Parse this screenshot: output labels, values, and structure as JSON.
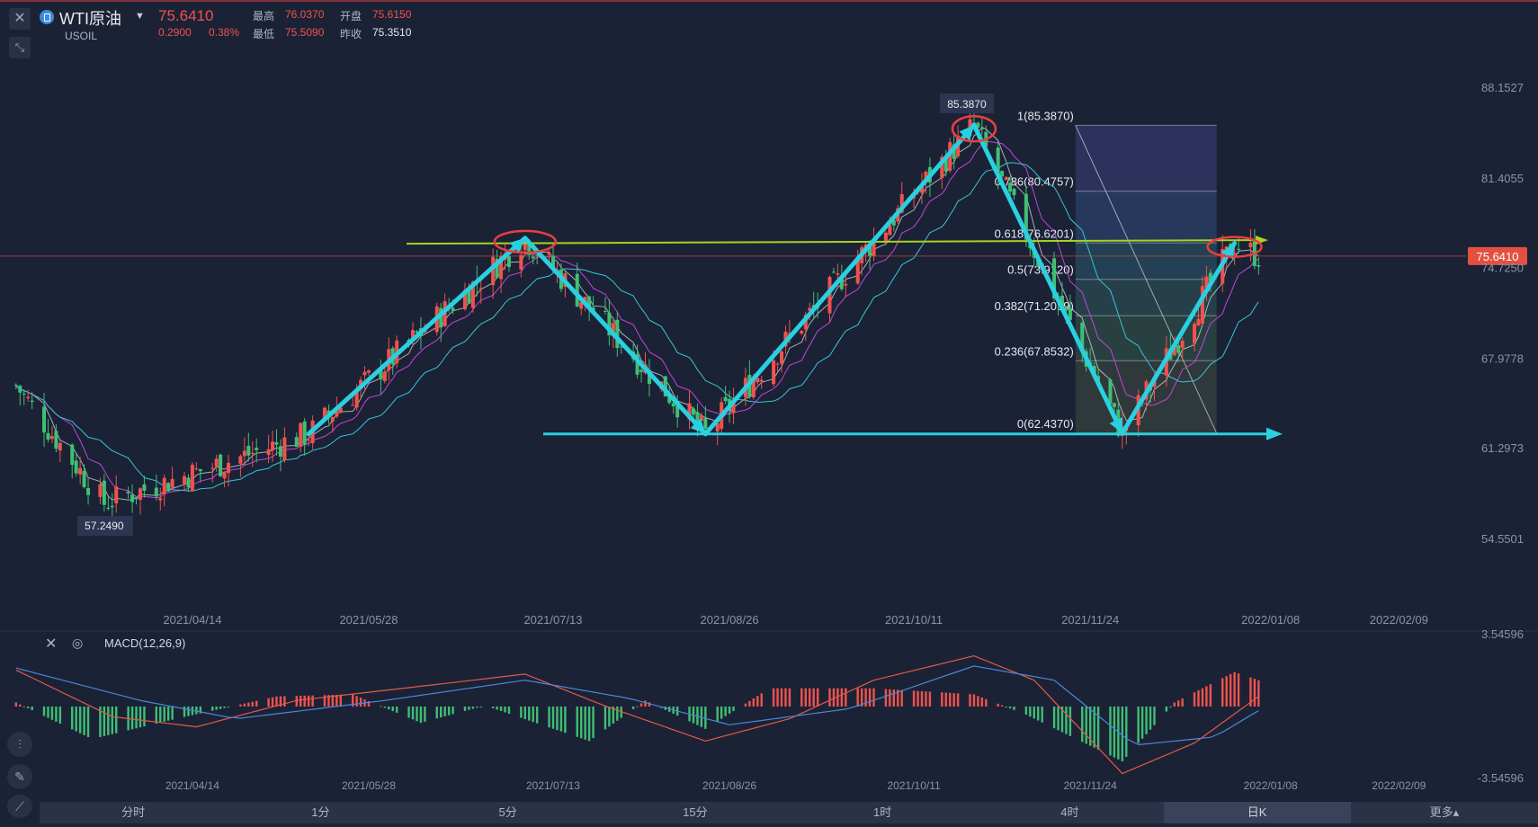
{
  "header": {
    "symbol_name": "WTI原油",
    "symbol_code": "USOIL",
    "last_price": "75.6410",
    "change": "0.2900",
    "change_pct": "0.38%",
    "high_label": "最高",
    "high": "76.0370",
    "open_label": "开盘",
    "open": "75.6150",
    "low_label": "最低",
    "low": "75.5090",
    "prev_close_label": "昨收",
    "prev_close": "75.3510"
  },
  "colors": {
    "background": "#1b2236",
    "up": "#f0524d",
    "down": "#3fbf74",
    "arrow": "#2ad0e0",
    "neckline": "#a8d320",
    "marker": "#e84040",
    "ma_magenta": "#c246d6",
    "ma_cyan": "#35c7d6",
    "macd_line": "#e15a46",
    "signal_line": "#4a87d6"
  },
  "chart_data": [
    {
      "type": "candlestick",
      "title": "",
      "x": [
        "2021/04/14",
        "2021/05/28",
        "2021/07/13",
        "2021/08/26",
        "2021/10/11",
        "2021/11/24",
        "2022/01/08",
        "2022/02/09"
      ],
      "y_ticks": [
        "88.1527",
        "81.4055",
        "74.7250",
        "67.9778",
        "61.2973",
        "54.5501"
      ],
      "ylim": [
        52.5,
        89.5
      ],
      "last_price_tag": "75.6410",
      "high_marker": "85.3870",
      "low_marker": "57.2490",
      "swing_points": [
        {
          "date": "2021/03/01",
          "value": 66.0
        },
        {
          "date": "2021/03/23",
          "value": 57.25
        },
        {
          "date": "2021/05/13",
          "value": 62.4
        },
        {
          "date": "2021/07/06",
          "value": 76.98
        },
        {
          "date": "2021/08/20",
          "value": 62.4
        },
        {
          "date": "2021/10/26",
          "value": 85.39
        },
        {
          "date": "2021/12/02",
          "value": 62.44
        },
        {
          "date": "2021/12/30",
          "value": 76.6
        },
        {
          "date": "2022/01/05",
          "value": 75.64
        }
      ],
      "fibonacci": {
        "levels": [
          {
            "ratio": "1",
            "value": "85.3870",
            "label": "1(85.3870)"
          },
          {
            "ratio": "0.786",
            "value": "80.4757",
            "label": "0.786(80.4757)"
          },
          {
            "ratio": "0.618",
            "value": "76.6201",
            "label": "0.618(76.6201)"
          },
          {
            "ratio": "0.5",
            "value": "73.9120",
            "label": "0.5(73.9120)"
          },
          {
            "ratio": "0.382",
            "value": "71.2039",
            "label": "0.382(71.2039)"
          },
          {
            "ratio": "0.236",
            "value": "67.8532",
            "label": "0.236(67.8532)"
          },
          {
            "ratio": "0",
            "value": "62.4370",
            "label": "0(62.4370)"
          }
        ]
      },
      "neckline_value": 76.7,
      "support_value": 62.4
    },
    {
      "type": "bar",
      "indicator_label": "MACD(12,26,9)",
      "y_ticks": [
        "3.54596",
        "-3.54596"
      ],
      "ylim": [
        -3.54596,
        3.54596
      ],
      "x": [
        "2021/04/14",
        "2021/05/28",
        "2021/07/13",
        "2021/08/26",
        "2021/10/11",
        "2021/11/24",
        "2022/01/08",
        "2022/02/09"
      ],
      "histogram_points": [
        {
          "date": "2021/03/01",
          "value": 0.2
        },
        {
          "date": "2021/03/20",
          "value": -1.6
        },
        {
          "date": "2021/04/10",
          "value": -0.6
        },
        {
          "date": "2021/05/05",
          "value": 0.5
        },
        {
          "date": "2021/05/24",
          "value": 0.6
        },
        {
          "date": "2021/06/10",
          "value": -0.8
        },
        {
          "date": "2021/06/26",
          "value": 0.05
        },
        {
          "date": "2021/07/22",
          "value": -1.7
        },
        {
          "date": "2021/08/05",
          "value": 0.3
        },
        {
          "date": "2021/08/20",
          "value": -1.1
        },
        {
          "date": "2021/09/05",
          "value": 0.9
        },
        {
          "date": "2021/10/01",
          "value": 0.9
        },
        {
          "date": "2021/10/26",
          "value": 0.6
        },
        {
          "date": "2021/11/08",
          "value": -0.4
        },
        {
          "date": "2021/12/02",
          "value": -2.7
        },
        {
          "date": "2021/12/15",
          "value": 0.2
        },
        {
          "date": "2021/12/30",
          "value": 1.7
        },
        {
          "date": "2022/01/05",
          "value": 1.3
        }
      ],
      "macd_points": [
        {
          "date": "2021/03/01",
          "value": 1.8
        },
        {
          "date": "2021/03/25",
          "value": -0.5
        },
        {
          "date": "2021/04/15",
          "value": -1.0
        },
        {
          "date": "2021/05/10",
          "value": 0.3
        },
        {
          "date": "2021/06/10",
          "value": 1.0
        },
        {
          "date": "2021/07/06",
          "value": 1.6
        },
        {
          "date": "2021/07/25",
          "value": 0.1
        },
        {
          "date": "2021/08/20",
          "value": -1.7
        },
        {
          "date": "2021/09/10",
          "value": -0.6
        },
        {
          "date": "2021/10/01",
          "value": 1.3
        },
        {
          "date": "2021/10/26",
          "value": 2.5
        },
        {
          "date": "2021/11/10",
          "value": 1.3
        },
        {
          "date": "2021/12/02",
          "value": -3.3
        },
        {
          "date": "2021/12/20",
          "value": -1.8
        },
        {
          "date": "2022/01/05",
          "value": 0.5
        }
      ],
      "signal_points": [
        {
          "date": "2021/03/01",
          "value": 1.9
        },
        {
          "date": "2021/04/01",
          "value": 0.3
        },
        {
          "date": "2021/04/25",
          "value": -0.6
        },
        {
          "date": "2021/06/01",
          "value": 0.3
        },
        {
          "date": "2021/07/06",
          "value": 1.3
        },
        {
          "date": "2021/08/01",
          "value": 0.4
        },
        {
          "date": "2021/08/26",
          "value": -0.9
        },
        {
          "date": "2021/09/25",
          "value": -0.1
        },
        {
          "date": "2021/10/26",
          "value": 2.0
        },
        {
          "date": "2021/11/15",
          "value": 1.3
        },
        {
          "date": "2021/12/05",
          "value": -1.9
        },
        {
          "date": "2021/12/25",
          "value": -1.5
        },
        {
          "date": "2022/01/05",
          "value": -0.2
        }
      ]
    }
  ],
  "timeframes": [
    {
      "label": "分时"
    },
    {
      "label": "1分"
    },
    {
      "label": "5分"
    },
    {
      "label": "15分"
    },
    {
      "label": "1时"
    },
    {
      "label": "4时"
    },
    {
      "label": "日K",
      "active": true
    },
    {
      "label": "更多▴"
    }
  ]
}
